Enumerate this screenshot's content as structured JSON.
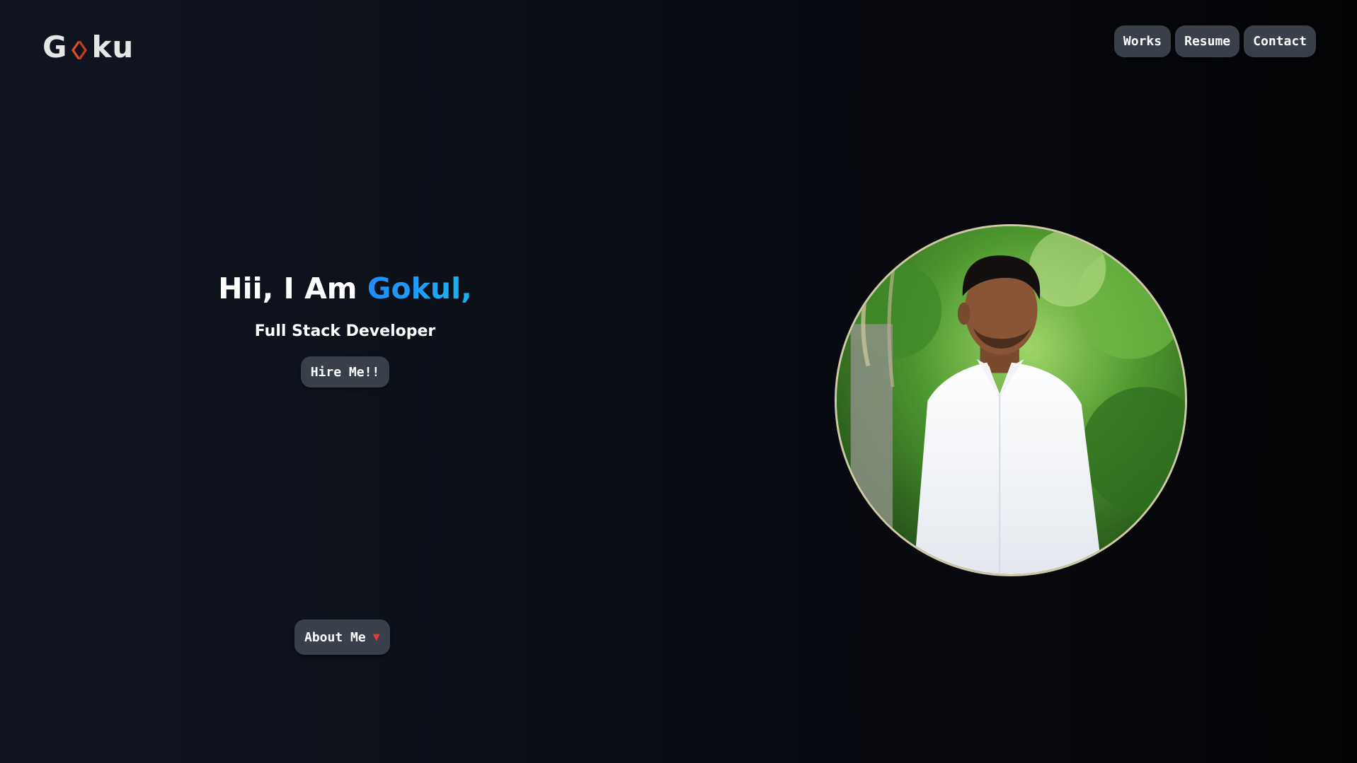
{
  "header": {
    "logo": {
      "text_before": "G",
      "text_after": "ku"
    },
    "nav": [
      {
        "label": "Works"
      },
      {
        "label": "Resume"
      },
      {
        "label": "Contact"
      }
    ]
  },
  "hero": {
    "greeting": "Hii, I Am ",
    "name": "Gokul,",
    "role": "Full Stack Developer",
    "cta_label": "Hire Me!!"
  },
  "about_button": {
    "label": "About Me",
    "arrow": "▼"
  },
  "colors": {
    "name_gradient_start": "#1e8cff",
    "name_gradient_end": "#19b4f0",
    "button_bg": "#3a4049",
    "logo_accent": "#e04a2a",
    "portrait_border": "#cfc9a6",
    "arrow": "#e53935"
  },
  "portrait": {
    "icon": "profile-photo"
  }
}
